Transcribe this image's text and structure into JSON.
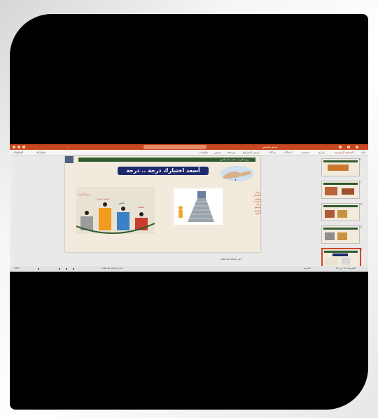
{
  "window": {
    "title": "عرض تقديمي",
    "quick_access": "..."
  },
  "ribbon": {
    "tabs": [
      "ملف",
      "الصفحة الرئيسية",
      "إدراج",
      "تصميم",
      "انتقالات",
      "حركات",
      "عرض الشرائح",
      "مراجعة",
      "عرض",
      "تعليمات"
    ],
    "active_tab_index": 1,
    "share_label": "مشاركة",
    "comments_label": "التعليقات"
  },
  "slide": {
    "banner_text": "وزارة التربية / مكتب تعليم الخرج",
    "title": "أسعد اختبارك درجة .. درجة",
    "word_list": [
      "مراحل",
      "التحسين",
      "وتطوير",
      "المهارات",
      "درجة",
      "وتنوعها",
      "لتحقيق",
      "النجاح"
    ],
    "podium_labels": [
      "سير الأشياء",
      "فرصة كبيرة",
      "التغيير",
      "حققت"
    ]
  },
  "thumbnails": {
    "numbers": [
      "8",
      "9",
      "10",
      "11",
      "12"
    ],
    "selected_index": 4
  },
  "notes": {
    "placeholder": "انقر لإضافة ملاحظات"
  },
  "status": {
    "slide_info": "الشريحة 12 من 12",
    "language": "العربية",
    "zoom": "58%"
  },
  "colors": {
    "titlebar": "#c9471f",
    "slide_title_bg": "#1f2a6d",
    "banner_bg": "#2f5a2e",
    "selection": "#d24726"
  }
}
